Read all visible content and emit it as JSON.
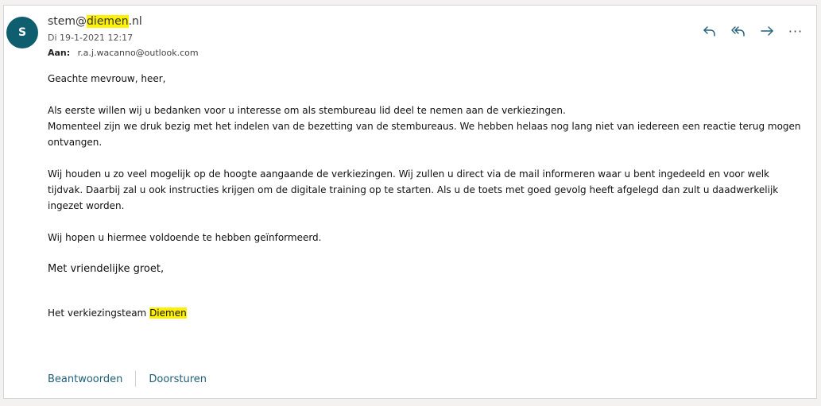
{
  "message": {
    "avatar_initial": "S",
    "sender": {
      "prefix": "stem@",
      "highlight": "diemen",
      "suffix": ".nl"
    },
    "date": "Di 19-1-2021 12:17",
    "to_label": "Aan:",
    "to_value": "r.a.j.wacanno@outlook.com",
    "actions": {
      "reply_icon": "reply-icon",
      "reply_all_icon": "reply-all-icon",
      "forward_icon": "forward-icon",
      "more_icon": "more-icon",
      "more_glyph": "···"
    },
    "body": {
      "greeting": "Geachte mevrouw, heer,",
      "para1_line1": "Als eerste willen wij u bedanken voor u interesse om als stembureau lid  deel te nemen aan de verkiezingen.",
      "para1_line2": "Momenteel zijn we druk bezig met het indelen van de bezetting van de stembureaus. We hebben helaas nog lang niet van iedereen een reactie terug mogen ontvangen.",
      "para2": "Wij houden u zo veel mogelijk op de hoogte aangaande de verkiezingen. Wij zullen u direct via de mail informeren waar u bent ingedeeld en voor welk tijdvak. Daarbij zal u ook instructies krijgen om de digitale training op te starten. Als u de toets met goed gevolg heeft afgelegd dan zult u daadwerkelijk ingezet worden.",
      "para3": "Wij hopen u hiermee voldoende te hebben geïnformeerd.",
      "closing": "Met vriendelijke groet,",
      "signature_prefix": "Het verkiezingsteam ",
      "signature_highlight": "Diemen"
    },
    "footer": {
      "reply_label": "Beantwoorden",
      "forward_label": "Doorsturen"
    }
  },
  "colors": {
    "avatar": "#0f5e6f",
    "highlight": "#fff100",
    "link": "#1f5f78",
    "icon": "#1f5f78"
  }
}
